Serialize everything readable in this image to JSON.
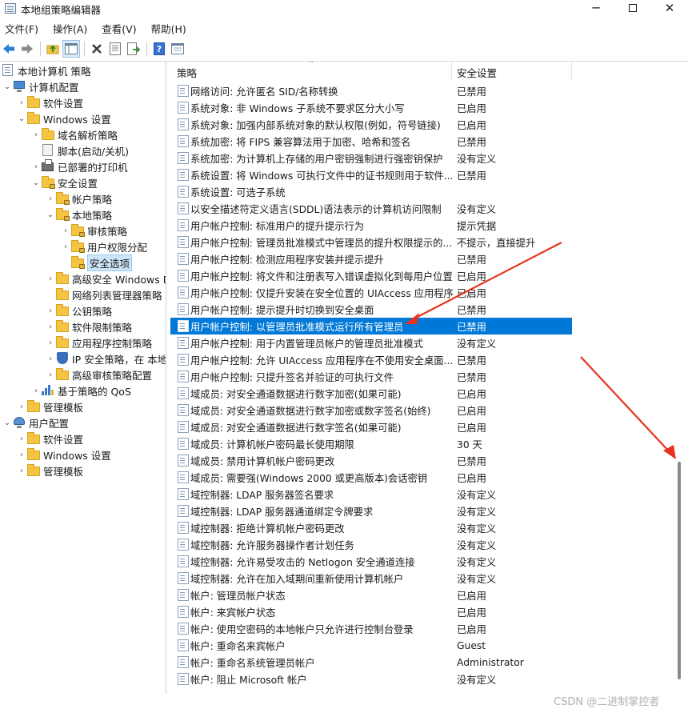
{
  "window": {
    "title": "本地组策略编辑器"
  },
  "menu": [
    "文件(F)",
    "操作(A)",
    "查看(V)",
    "帮助(H)"
  ],
  "toolbar": {
    "icons": [
      "back-icon",
      "forward-icon",
      "up-folder-icon",
      "show-hide-tree-icon",
      "delete-icon",
      "properties-icon",
      "export-icon",
      "help-icon",
      "view-icon"
    ]
  },
  "tree": [
    {
      "label": "本地计算机 策略",
      "icon": "policy-icon"
    },
    {
      "label": "计算机配置",
      "icon": "computer-icon"
    },
    {
      "label": "软件设置",
      "icon": "folder-icon"
    },
    {
      "label": "Windows 设置",
      "icon": "folder-icon"
    },
    {
      "label": "域名解析策略",
      "icon": "folder-icon"
    },
    {
      "label": "脚本(启动/关机)",
      "icon": "script-icon"
    },
    {
      "label": "已部署的打印机",
      "icon": "printer-icon"
    },
    {
      "label": "安全设置",
      "icon": "security-folder-icon"
    },
    {
      "label": "帐户策略",
      "icon": "security-folder-icon"
    },
    {
      "label": "本地策略",
      "icon": "security-folder-icon"
    },
    {
      "label": "审核策略",
      "icon": "security-folder-icon"
    },
    {
      "label": "用户权限分配",
      "icon": "security-folder-icon"
    },
    {
      "label": "安全选项",
      "icon": "security-folder-icon"
    },
    {
      "label": "高级安全 Windows D",
      "icon": "folder-icon"
    },
    {
      "label": "网络列表管理器策略",
      "icon": "folder-icon"
    },
    {
      "label": "公钥策略",
      "icon": "folder-icon"
    },
    {
      "label": "软件限制策略",
      "icon": "folder-icon"
    },
    {
      "label": "应用程序控制策略",
      "icon": "folder-icon"
    },
    {
      "label": "IP 安全策略，在 本地",
      "icon": "shield-icon"
    },
    {
      "label": "高级审核策略配置",
      "icon": "folder-icon"
    },
    {
      "label": "基于策略的 QoS",
      "icon": "chart-icon"
    },
    {
      "label": "管理模板",
      "icon": "folder-icon"
    },
    {
      "label": "用户配置",
      "icon": "user-icon"
    },
    {
      "label": "软件设置",
      "icon": "folder-icon"
    },
    {
      "label": "Windows 设置",
      "icon": "folder-icon"
    },
    {
      "label": "管理模板",
      "icon": "folder-icon"
    }
  ],
  "columns": {
    "policy": "策略",
    "setting": "安全设置"
  },
  "rows": [
    {
      "name": "网络访问: 允许匿名 SID/名称转换",
      "value": "已禁用"
    },
    {
      "name": "系统对象: 非 Windows 子系统不要求区分大小写",
      "value": "已启用"
    },
    {
      "name": "系统对象: 加强内部系统对象的默认权限(例如，符号链接)",
      "value": "已启用"
    },
    {
      "name": "系统加密: 将 FIPS 兼容算法用于加密、哈希和签名",
      "value": "已禁用"
    },
    {
      "name": "系统加密: 为计算机上存储的用户密钥强制进行强密钥保护",
      "value": "没有定义"
    },
    {
      "name": "系统设置: 将 Windows 可执行文件中的证书规则用于软件...",
      "value": "已禁用"
    },
    {
      "name": "系统设置: 可选子系统",
      "value": ""
    },
    {
      "name": "以安全描述符定义语言(SDDL)语法表示的计算机访问限制",
      "value": "没有定义"
    },
    {
      "name": "用户帐户控制: 标准用户的提升提示行为",
      "value": "提示凭据"
    },
    {
      "name": "用户帐户控制: 管理员批准模式中管理员的提升权限提示的...",
      "value": "不提示，直接提升"
    },
    {
      "name": "用户帐户控制: 检测应用程序安装并提示提升",
      "value": "已禁用"
    },
    {
      "name": "用户帐户控制: 将文件和注册表写入错误虚拟化到每用户位置",
      "value": "已启用"
    },
    {
      "name": "用户帐户控制: 仅提升安装在安全位置的 UIAccess 应用程序",
      "value": "已启用"
    },
    {
      "name": "用户帐户控制: 提示提升时切换到安全桌面",
      "value": "已禁用"
    },
    {
      "name": "用户帐户控制: 以管理员批准模式运行所有管理员",
      "value": "已禁用"
    },
    {
      "name": "用户帐户控制: 用于内置管理员帐户的管理员批准模式",
      "value": "没有定义"
    },
    {
      "name": "用户帐户控制: 允许 UIAccess 应用程序在不使用安全桌面...",
      "value": "已禁用"
    },
    {
      "name": "用户帐户控制: 只提升签名并验证的可执行文件",
      "value": "已禁用"
    },
    {
      "name": "域成员: 对安全通道数据进行数字加密(如果可能)",
      "value": "已启用"
    },
    {
      "name": "域成员: 对安全通道数据进行数字加密或数字签名(始终)",
      "value": "已启用"
    },
    {
      "name": "域成员: 对安全通道数据进行数字签名(如果可能)",
      "value": "已启用"
    },
    {
      "name": "域成员: 计算机帐户密码最长使用期限",
      "value": "30 天"
    },
    {
      "name": "域成员: 禁用计算机帐户密码更改",
      "value": "已禁用"
    },
    {
      "name": "域成员: 需要强(Windows 2000 或更高版本)会话密钥",
      "value": "已启用"
    },
    {
      "name": "域控制器: LDAP 服务器签名要求",
      "value": "没有定义"
    },
    {
      "name": "域控制器: LDAP 服务器通道绑定令牌要求",
      "value": "没有定义"
    },
    {
      "name": "域控制器: 拒绝计算机帐户密码更改",
      "value": "没有定义"
    },
    {
      "name": "域控制器: 允许服务器操作者计划任务",
      "value": "没有定义"
    },
    {
      "name": "域控制器: 允许易受攻击的 Netlogon 安全通道连接",
      "value": "没有定义"
    },
    {
      "name": "域控制器:   允许在加入域期间重新使用计算机帐户",
      "value": "没有定义"
    },
    {
      "name": "帐户: 管理员帐户状态",
      "value": "已启用"
    },
    {
      "name": "帐户: 来宾帐户状态",
      "value": "已启用"
    },
    {
      "name": "帐户: 使用空密码的本地帐户只允许进行控制台登录",
      "value": "已启用"
    },
    {
      "name": "帐户: 重命名来宾帐户",
      "value": "Guest"
    },
    {
      "name": "帐户: 重命名系统管理员帐户",
      "value": "Administrator"
    },
    {
      "name": "帐户: 阻止 Microsoft 帐户",
      "value": "没有定义"
    }
  ],
  "selected_row": 14,
  "accent": "#0078d7",
  "annotation_color": "#e8321f",
  "watermark": "CSDN @二进制掌控者"
}
